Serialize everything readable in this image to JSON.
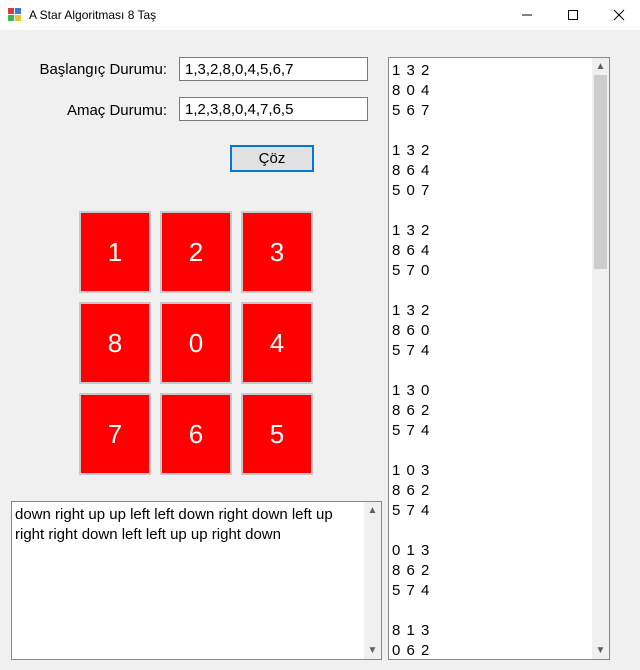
{
  "window": {
    "title": "A Star Algoritması 8 Taş",
    "minimize_icon": "minimize-icon",
    "maximize_icon": "maximize-icon",
    "close_icon": "close-icon"
  },
  "form": {
    "start_label": "Başlangıç Durumu:",
    "start_value": "1,3,2,8,0,4,5,6,7",
    "goal_label": "Amaç Durumu:",
    "goal_value": "1,2,3,8,0,4,7,6,5",
    "solve_label": "Çöz"
  },
  "tiles": [
    "1",
    "2",
    "3",
    "8",
    "0",
    "4",
    "7",
    "6",
    "5"
  ],
  "moves_text": "down right up up left left down right down left up right right down left left up up right down",
  "states": [
    [
      "1 3 2",
      "8 0 4",
      "5 6 7"
    ],
    [
      "1 3 2",
      "8 6 4",
      "5 0 7"
    ],
    [
      "1 3 2",
      "8 6 4",
      "5 7 0"
    ],
    [
      "1 3 2",
      "8 6 0",
      "5 7 4"
    ],
    [
      "1 3 0",
      "8 6 2",
      "5 7 4"
    ],
    [
      "1 0 3",
      "8 6 2",
      "5 7 4"
    ],
    [
      "0 1 3",
      "8 6 2",
      "5 7 4"
    ],
    [
      "8 1 3",
      "0 6 2"
    ]
  ],
  "colors": {
    "tile": "#ff0000",
    "accent": "#0078d7"
  }
}
